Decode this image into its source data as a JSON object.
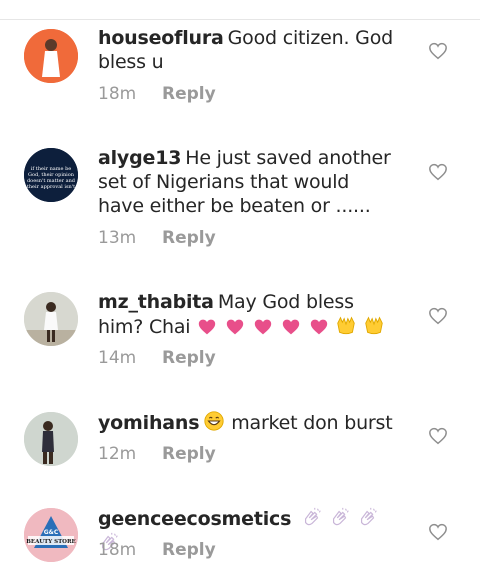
{
  "comments": [
    {
      "username": "houseoflura",
      "text": "Good citizen. God bless u",
      "time": "18m",
      "reply_label": "Reply",
      "avatar_bg": "#f06a3a"
    },
    {
      "username": "alyge13",
      "text": "He just saved another set of Nigerians that would have either be beaten or ......",
      "time": "13m",
      "reply_label": "Reply",
      "avatar_bg": "#0d1f3c",
      "avatar_text": "if their name be God, their opinion doesn't matter and their approval isn't needed"
    },
    {
      "username": "mz_thabita",
      "text": "May God bless him? Chai",
      "time": "14m",
      "reply_label": "Reply",
      "avatar_bg": "#d7d8d0"
    },
    {
      "username": "yomihans",
      "text": "market don burst",
      "time": "12m",
      "reply_label": "Reply",
      "avatar_bg": "#cfd6cf"
    },
    {
      "username": "geenceecosmetics",
      "text": "",
      "time": "18m",
      "reply_label": "Reply",
      "avatar_bg": "#f0b9c0",
      "avatar_text": "G&C BEAUTY STORE"
    }
  ],
  "icons": {
    "like": "heart-outline-icon",
    "heart_emoji": "heart-emoji-icon",
    "raised_hands_emoji": "raised-hands-emoji-icon",
    "grin_emoji": "grinning-face-emoji-icon",
    "clap_emoji": "clapping-hands-emoji-icon"
  },
  "colors": {
    "heart": "#e84f8a",
    "meta_text": "#9a9a9a",
    "emoji_yellow": "#ffcc33"
  }
}
